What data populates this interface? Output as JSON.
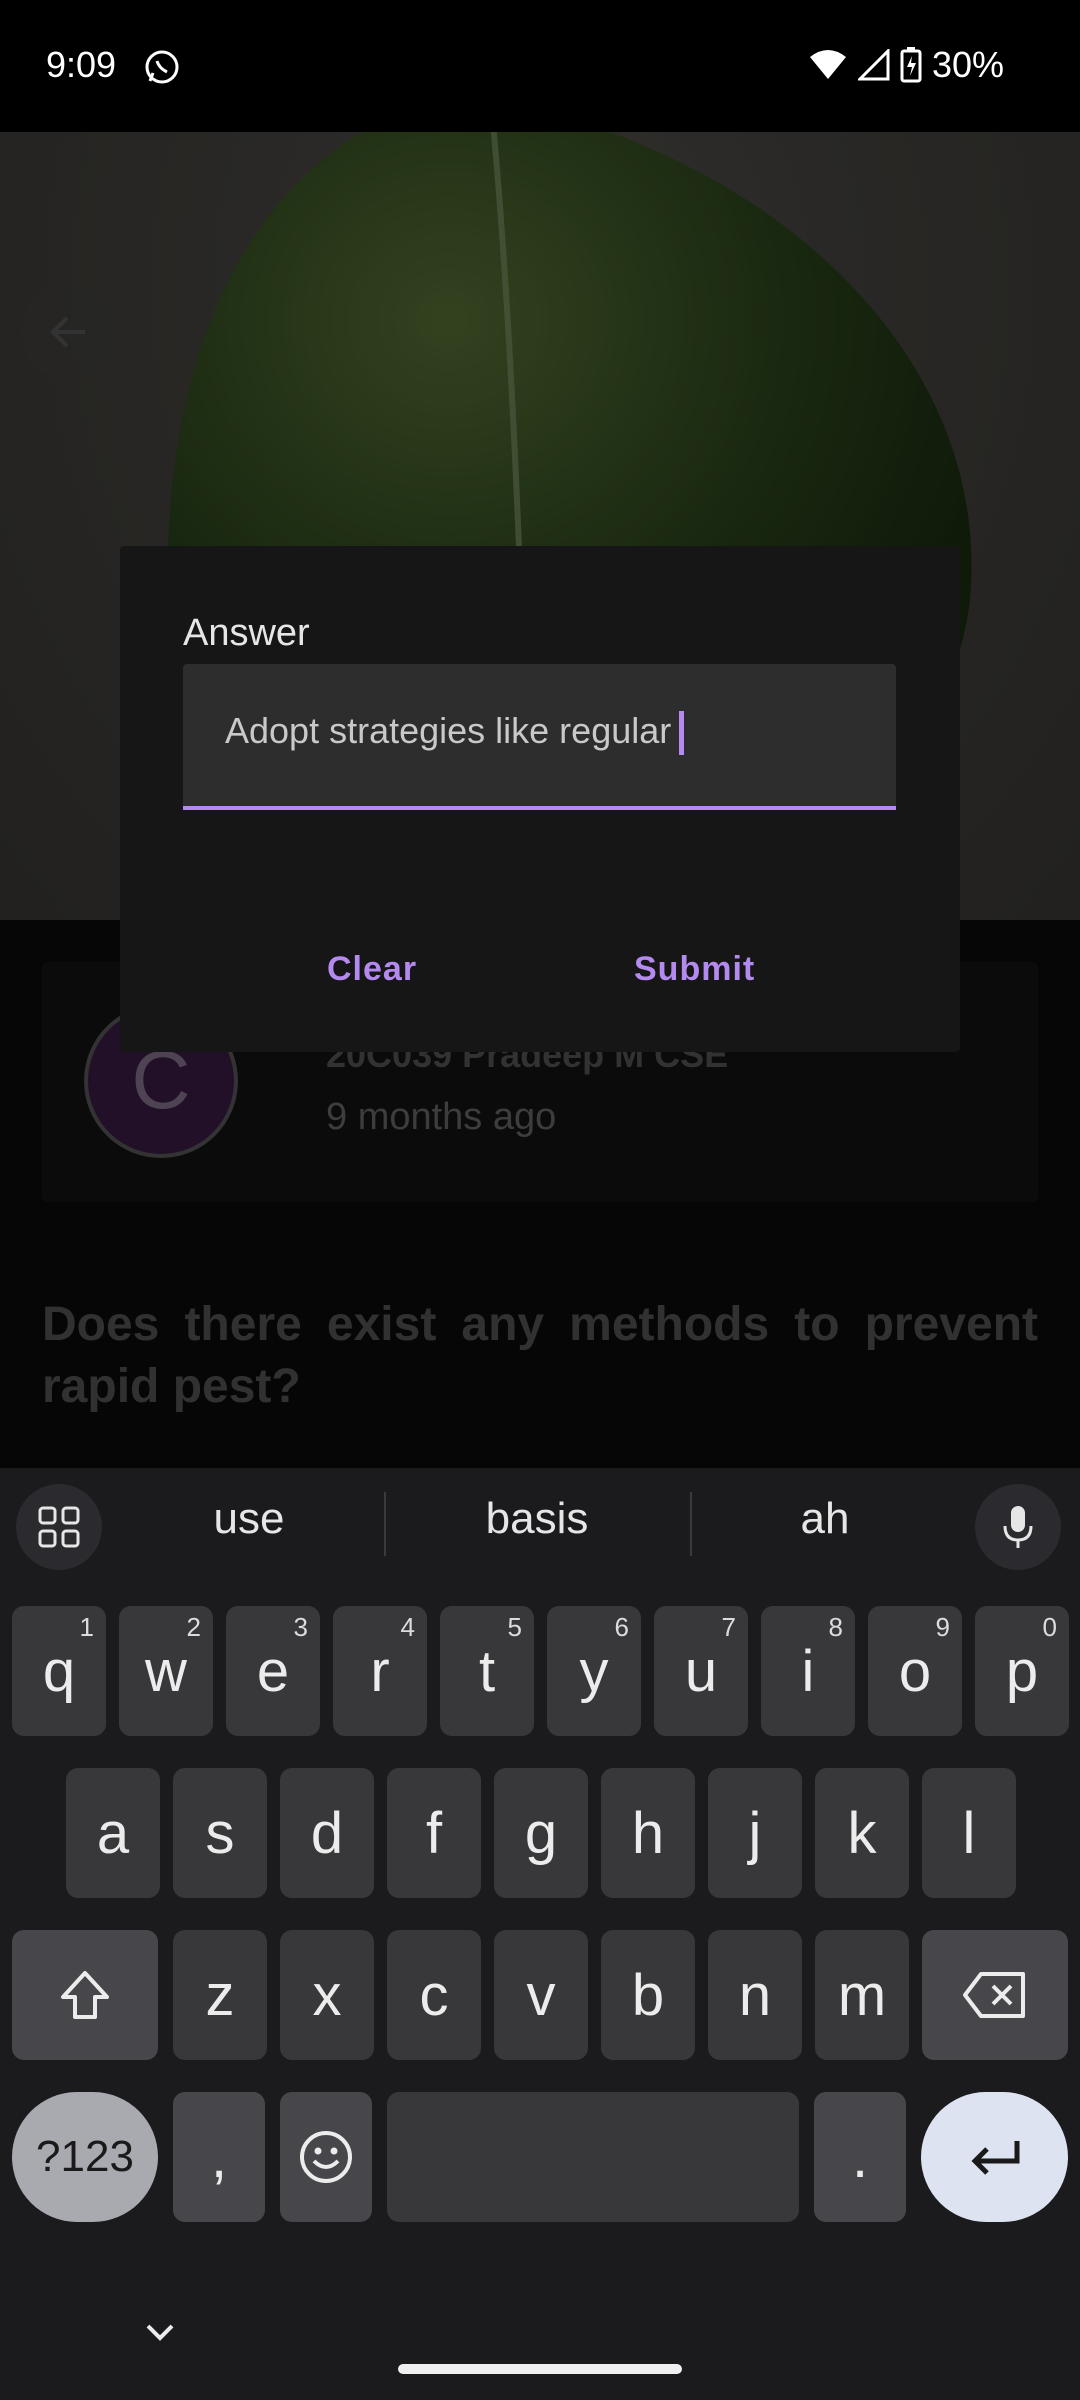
{
  "status_bar": {
    "time": "9:09",
    "battery": "30%"
  },
  "dialog": {
    "label": "Answer",
    "input_value": "Adopt strategies like regular",
    "clear_label": "Clear",
    "submit_label": "Submit"
  },
  "author": {
    "avatar_letter": "C",
    "name": "20C039 Pradeep M CSE",
    "time": "9 months ago"
  },
  "question": "Does there exist any methods to prevent rapid pest?",
  "keyboard": {
    "suggestions": [
      "use",
      "basis",
      "ah"
    ],
    "row1": [
      {
        "k": "q",
        "h": "1"
      },
      {
        "k": "w",
        "h": "2"
      },
      {
        "k": "e",
        "h": "3"
      },
      {
        "k": "r",
        "h": "4"
      },
      {
        "k": "t",
        "h": "5"
      },
      {
        "k": "y",
        "h": "6"
      },
      {
        "k": "u",
        "h": "7"
      },
      {
        "k": "i",
        "h": "8"
      },
      {
        "k": "o",
        "h": "9"
      },
      {
        "k": "p",
        "h": "0"
      }
    ],
    "row2": [
      "a",
      "s",
      "d",
      "f",
      "g",
      "h",
      "j",
      "k",
      "l"
    ],
    "row3": [
      "z",
      "x",
      "c",
      "v",
      "b",
      "n",
      "m"
    ],
    "symbols_label": "?123",
    "comma": ",",
    "period": "."
  },
  "colors": {
    "accent": "#b58af0",
    "dialog_bg": "#161616",
    "keyboard_bg": "#1b1b1e"
  }
}
